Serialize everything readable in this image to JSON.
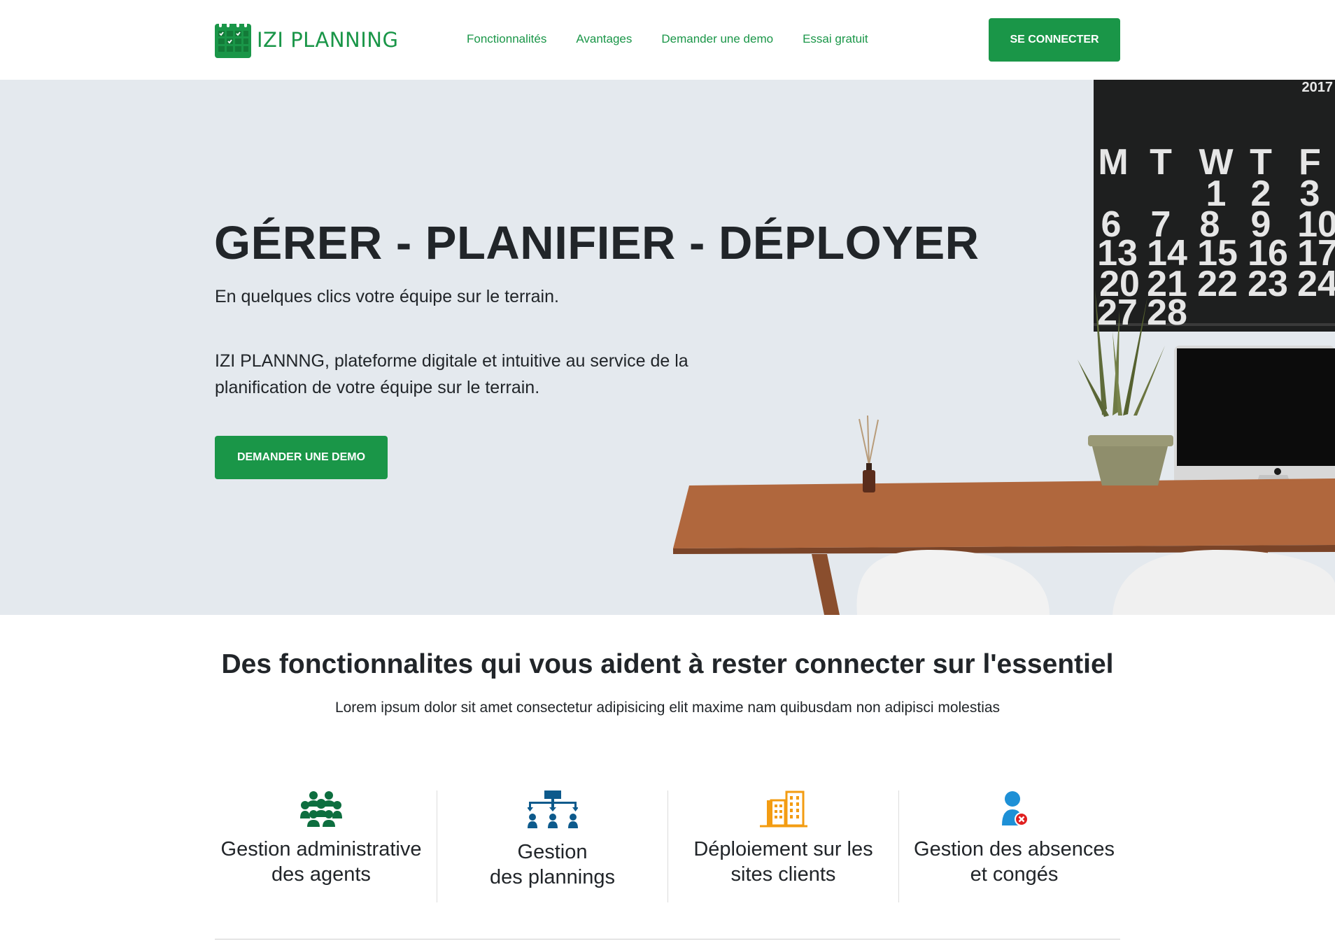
{
  "brand": {
    "name": "IZI PLANNING",
    "primary_color": "#1a9648"
  },
  "nav": {
    "items": [
      {
        "label": "Fonctionnalités"
      },
      {
        "label": "Avantages"
      },
      {
        "label": "Demander une demo"
      },
      {
        "label": "Essai gratuit"
      }
    ],
    "login_label": "SE CONNECTER"
  },
  "hero": {
    "title": "GÉRER - PLANIFIER - DÉPLOYER",
    "subtitle": "En quelques clics votre équipe sur le terrain.",
    "description": "IZI PLANNNG, plateforme digitale et intuitive au service de la planification de votre équipe sur le terrain.",
    "cta_label": "DEMANDER UNE DEMO",
    "calendar": {
      "year": "2017",
      "days": [
        "M",
        "T",
        "W",
        "T",
        "F"
      ],
      "dates": [
        "1",
        "2",
        "3",
        "6",
        "7",
        "8",
        "9",
        "10",
        "13",
        "14",
        "15",
        "16",
        "17",
        "20",
        "21",
        "22",
        "23",
        "24",
        "27",
        "28"
      ]
    }
  },
  "features": {
    "title": "Des fonctionnalites qui vous aident à rester connecter sur l'essentiel",
    "subtitle": "Lorem ipsum dolor sit amet consectetur adipisicing elit maxime nam quibusdam non adipisci molestias",
    "items": [
      {
        "line1": "Gestion administrative",
        "line2": "des agents",
        "icon": "group-icon",
        "color": "#0d6e3f"
      },
      {
        "line1": "Gestion",
        "line2": "des plannings",
        "icon": "org-chart-icon",
        "color": "#0d5a8c"
      },
      {
        "line1": "Déploiement sur les",
        "line2": "sites clients",
        "icon": "buildings-icon",
        "color": "#f39c12"
      },
      {
        "line1": "Gestion des absences",
        "line2": "et congés",
        "icon": "user-absence-icon",
        "color": "#1e90d6"
      }
    ]
  }
}
